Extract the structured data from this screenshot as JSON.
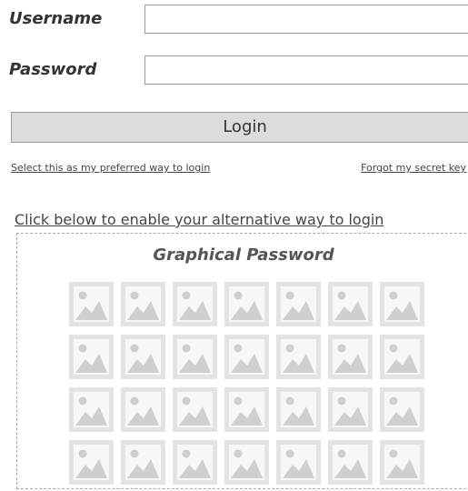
{
  "form": {
    "username_label": "Username",
    "password_label": "Password",
    "username_value": "",
    "password_value": "",
    "login_label": "Login"
  },
  "links": {
    "preferred": "Select this as my preferred way to login",
    "forgot": "Forgot my secret key",
    "alternative": "Click below to enable your alternative way to login"
  },
  "graphical": {
    "title": "Graphical Password",
    "rows": 4,
    "columns": 7,
    "tile_icon": "image-placeholder-icon"
  },
  "colors": {
    "tile_bg": "#e3e3e3",
    "tile_frame": "#f7f7f7",
    "tile_art": "#cfcfcf",
    "button_bg": "#dcdcdc",
    "border": "#9a9a9a"
  }
}
